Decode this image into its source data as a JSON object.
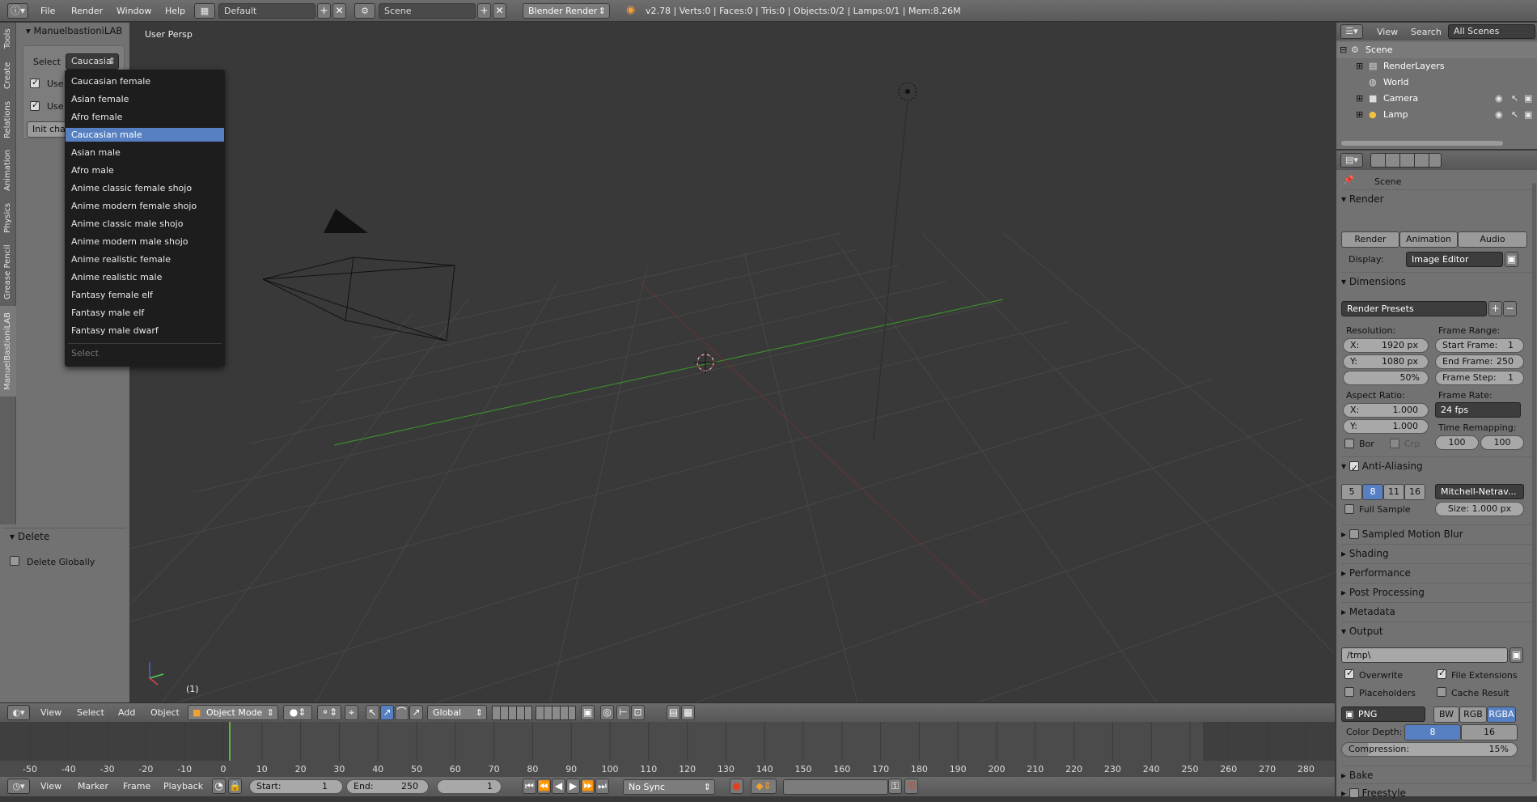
{
  "topbar": {
    "info_icon": "info-icon",
    "menus": [
      "File",
      "Render",
      "Window",
      "Help"
    ],
    "layout": "Default",
    "scene": "Scene",
    "engine": "Blender Render",
    "stats": "v2.78 | Verts:0 | Faces:0 | Tris:0 | Objects:0/2 | Lamps:0/1 | Mem:8.26M"
  },
  "toolshelf": {
    "tabs": [
      "Tools",
      "Create",
      "Relations",
      "Animation",
      "Physics",
      "Grease Pencil",
      "ManuelBastioniLAB"
    ],
    "panel_title": "ManuelbastioniLAB",
    "select_label": "Select",
    "select_value": "Caucasia",
    "use1": "Use",
    "use2": "Use",
    "init_btn": "Init cha",
    "delete_title": "Delete",
    "delete_globally": "Delete Globally"
  },
  "dropdown": {
    "options": [
      "Caucasian female",
      "Asian female",
      "Afro female",
      "Caucasian male",
      "Asian male",
      "Afro male",
      "Anime classic female shojo",
      "Anime modern female shojo",
      "Anime classic male shojo",
      "Anime modern male shojo",
      "Anime realistic female",
      "Anime realistic male",
      "Fantasy female elf",
      "Fantasy male elf",
      "Fantasy male dwarf"
    ],
    "selected_index": 3,
    "footer": "Select"
  },
  "viewport": {
    "label": "User Persp",
    "frame": "(1)"
  },
  "v3d_header": {
    "menus": [
      "View",
      "Select",
      "Add",
      "Object"
    ],
    "mode": "Object Mode",
    "orientation": "Global"
  },
  "timeline": {
    "ticks": [
      "-50",
      "-40",
      "-30",
      "-20",
      "-10",
      "0",
      "10",
      "20",
      "30",
      "40",
      "50",
      "60",
      "70",
      "80",
      "90",
      "100",
      "110",
      "120",
      "130",
      "140",
      "150",
      "160",
      "170",
      "180",
      "190",
      "200",
      "210",
      "220",
      "230",
      "240",
      "250",
      "260",
      "270",
      "280"
    ]
  },
  "footbar": {
    "menus": [
      "View",
      "Marker",
      "Frame",
      "Playback"
    ],
    "start": "Start:",
    "start_val": "1",
    "end": "End:",
    "end_val": "250",
    "current": "1",
    "sync": "No Sync"
  },
  "outliner": {
    "menus": [
      "View",
      "Search"
    ],
    "filter": "All Scenes",
    "items": [
      "Scene",
      "RenderLayers",
      "World",
      "Camera",
      "Lamp"
    ]
  },
  "props": {
    "context": "Scene",
    "render": "Render",
    "btn_render": "Render",
    "btn_anim": "Animation",
    "btn_audio": "Audio",
    "display_lbl": "Display:",
    "display_val": "Image Editor",
    "dimensions": "Dimensions",
    "presets": "Render Presets",
    "resolution": "Resolution:",
    "res_x": "X:",
    "res_x_val": "1920 px",
    "res_y": "Y:",
    "res_y_val": "1080 px",
    "res_pct": "50%",
    "frame_range": "Frame Range:",
    "start_frame": "Start Frame:",
    "start_frame_val": "1",
    "end_frame": "End Frame:",
    "end_frame_val": "250",
    "frame_step": "Frame Step:",
    "frame_step_val": "1",
    "aspect": "Aspect Ratio:",
    "asp_x": "X:",
    "asp_x_val": "1.000",
    "asp_y": "Y:",
    "asp_y_val": "1.000",
    "frame_rate": "Frame Rate:",
    "fps": "24 fps",
    "time_remap": "Time Remapping:",
    "remap_old": "100",
    "remap_new": "100",
    "bor": "Bor",
    "crop": "Crp",
    "aa": "Anti-Aliasing",
    "aa_samples": [
      "5",
      "8",
      "11",
      "16"
    ],
    "aa_filter": "Mitchell-Netrav...",
    "full_sample": "Full Sample",
    "size": "Size: 1.000 px",
    "smb": "Sampled Motion Blur",
    "shading": "Shading",
    "performance": "Performance",
    "post": "Post Processing",
    "metadata": "Metadata",
    "output": "Output",
    "path": "/tmp\\",
    "overwrite": "Overwrite",
    "file_ext": "File Extensions",
    "placeholders": "Placeholders",
    "cache_result": "Cache Result",
    "format": "PNG",
    "bw": "BW",
    "rgb": "RGB",
    "rgba": "RGBA",
    "color_depth": "Color Depth:",
    "depth8": "8",
    "depth16": "16",
    "compression": "Compression:",
    "compression_val": "15%",
    "bake": "Bake",
    "freestyle": "Freestyle"
  },
  "colors": {
    "accent": "#5680c2",
    "green_axis": "#3c8c2c",
    "red_axis": "#8c3030"
  }
}
